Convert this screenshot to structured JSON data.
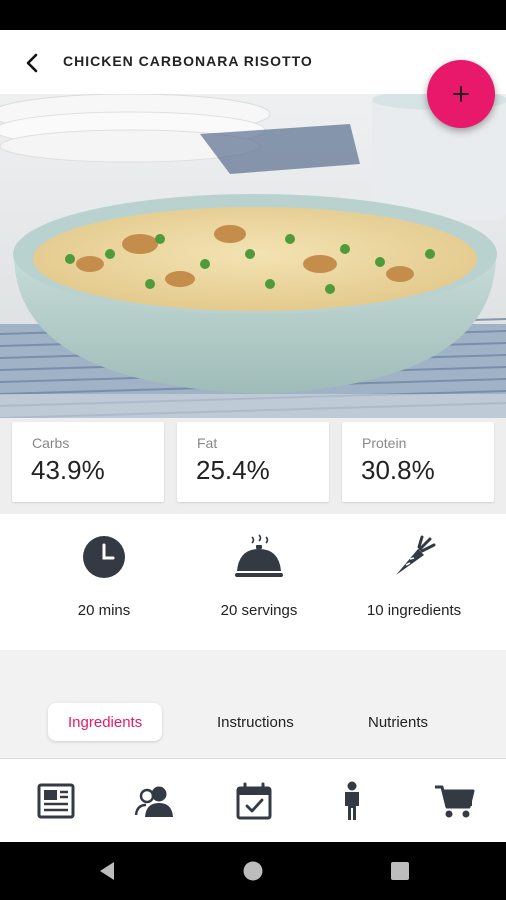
{
  "header": {
    "title": "CHICKEN CARBONARA RISOTTO",
    "back_icon": "arrow-back-icon"
  },
  "fab": {
    "icon": "plus-icon",
    "label": "+"
  },
  "macros": [
    {
      "label": "Carbs",
      "value": "43.9%"
    },
    {
      "label": "Fat",
      "value": "25.4%"
    },
    {
      "label": "Protein",
      "value": "30.8%"
    }
  ],
  "stats": [
    {
      "icon": "clock-icon",
      "label": "20 mins"
    },
    {
      "icon": "serving-dish-icon",
      "label": "20 servings"
    },
    {
      "icon": "carrot-icon",
      "label": "10 ingredients"
    }
  ],
  "tabs": [
    {
      "label": "Ingredients",
      "active": true
    },
    {
      "label": "Instructions",
      "active": false
    },
    {
      "label": "Nutrients",
      "active": false
    }
  ],
  "bottom_nav": [
    {
      "icon": "news-icon"
    },
    {
      "icon": "users-icon"
    },
    {
      "icon": "calendar-check-icon"
    },
    {
      "icon": "person-icon"
    },
    {
      "icon": "cart-icon"
    }
  ],
  "system_nav": [
    {
      "icon": "back-triangle-icon"
    },
    {
      "icon": "home-circle-icon"
    },
    {
      "icon": "recents-square-icon"
    }
  ],
  "colors": {
    "accent": "#e8196a",
    "text": "#222222",
    "muted": "#888888",
    "tabs_background": "#f2f2f2"
  }
}
